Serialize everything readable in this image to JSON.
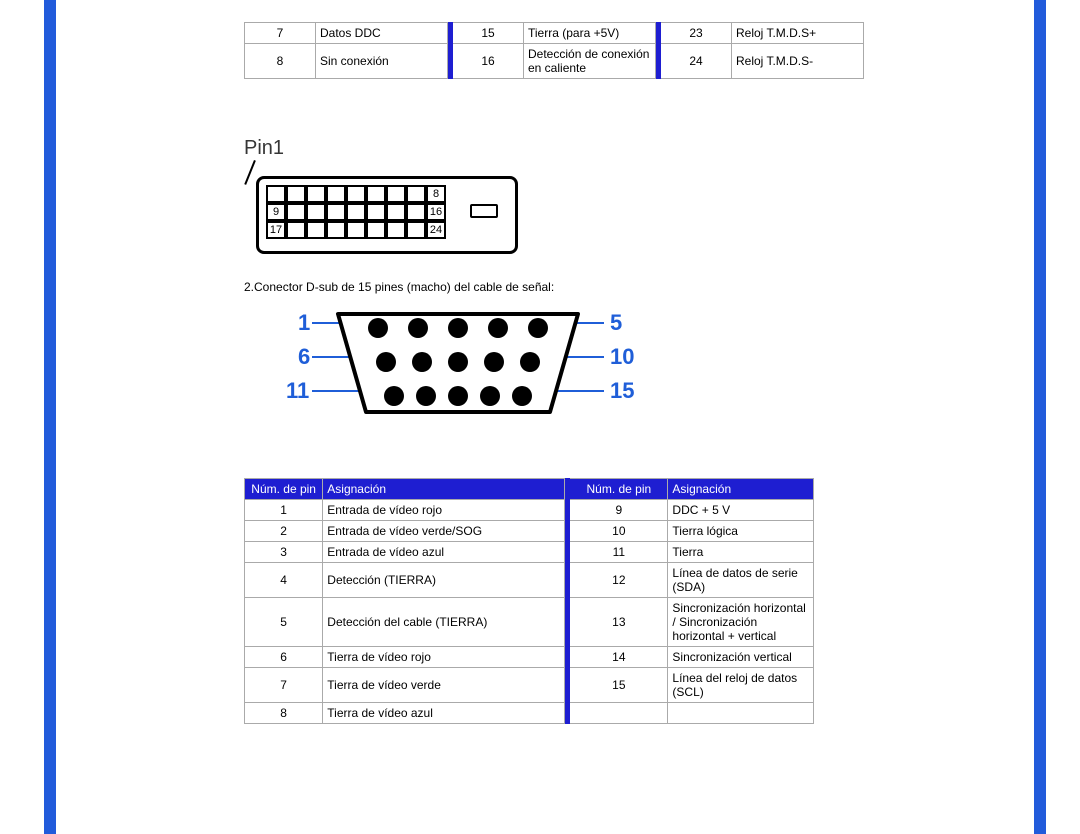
{
  "topTable": {
    "rows": [
      {
        "a": "7",
        "b": "Datos DDC",
        "c": "15",
        "d": "Tierra (para +5V)",
        "e": "23",
        "f": "Reloj T.M.D.S+"
      },
      {
        "a": "8",
        "b": "Sin conexión",
        "c": "16",
        "d": "Detección de conexión en caliente",
        "e": "24",
        "f": "Reloj T.M.D.S-"
      }
    ]
  },
  "dvi": {
    "pin1": "Pin1",
    "labels": {
      "r1c9": "8",
      "r2c1": "9",
      "r2c9": "16",
      "r3c1": "17",
      "r3c9": "24"
    }
  },
  "subCaption": "2.Conector D-sub de 15 pines (macho) del cable de señal:",
  "vga": {
    "left": {
      "r1": "1",
      "r2": "6",
      "r3": "11"
    },
    "right": {
      "r1": "5",
      "r2": "10",
      "r3": "15"
    }
  },
  "table2": {
    "head": {
      "a": "Núm. de pin",
      "b": "Asignación",
      "c": "Núm. de pin",
      "d": "Asignación"
    },
    "rows": [
      {
        "a": "1",
        "b": "Entrada de vídeo rojo",
        "c": "9",
        "d": "DDC + 5 V"
      },
      {
        "a": "2",
        "b": "Entrada de vídeo verde/SOG",
        "c": "10",
        "d": "Tierra lógica"
      },
      {
        "a": "3",
        "b": "Entrada de vídeo azul",
        "c": "11",
        "d": "Tierra"
      },
      {
        "a": "4",
        "b": "Detección (TIERRA)",
        "c": "12",
        "d": "Línea de datos de serie (SDA)"
      },
      {
        "a": "5",
        "b": "Detección del cable (TIERRA)",
        "c": "13",
        "d": "Sincronización horizontal / Sincronización horizontal + vertical"
      },
      {
        "a": "6",
        "b": "Tierra de vídeo rojo",
        "c": "14",
        "d": "Sincronización vertical"
      },
      {
        "a": "7",
        "b": "Tierra de vídeo verde",
        "c": "15",
        "d": "Línea del reloj de datos (SCL)"
      },
      {
        "a": "8",
        "b": "Tierra de vídeo azul",
        "c": "",
        "d": ""
      }
    ]
  }
}
